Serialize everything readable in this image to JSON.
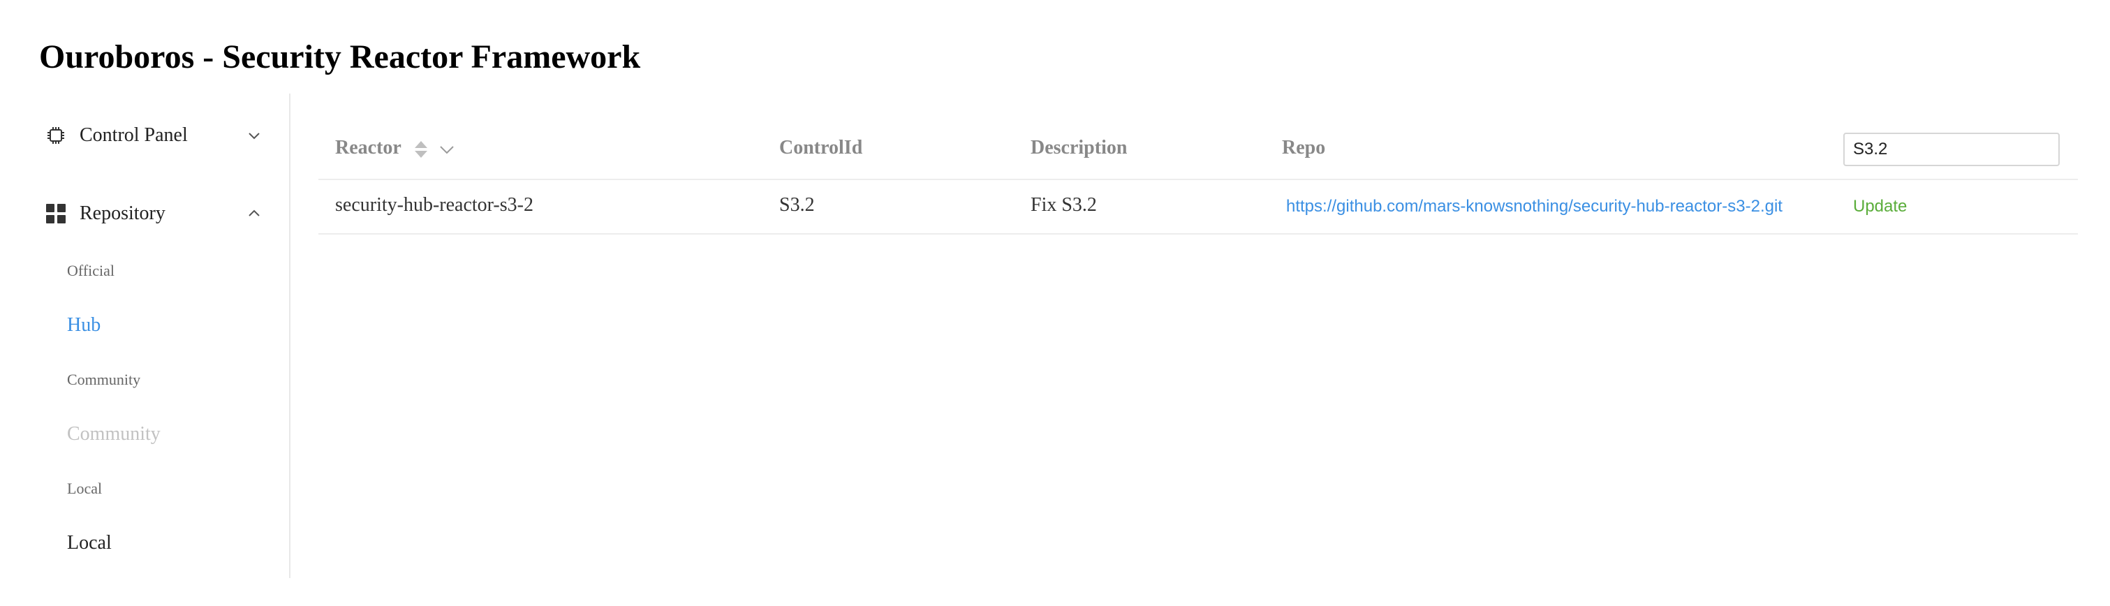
{
  "app": {
    "title": "Ouroboros - Security Reactor Framework"
  },
  "sidebar": {
    "control_panel": {
      "label": "Control Panel",
      "icon": "cpu-chip-icon",
      "expanded": false
    },
    "repository": {
      "label": "Repository",
      "icon": "grid-icon",
      "expanded": true,
      "items": [
        {
          "label": "Official",
          "state": "normal"
        },
        {
          "label": "Hub",
          "state": "selected"
        },
        {
          "label": "Community",
          "state": "normal"
        },
        {
          "label": "Community",
          "state": "disabled"
        },
        {
          "label": "Local",
          "state": "normal"
        },
        {
          "label": "Local",
          "state": "normal"
        }
      ]
    }
  },
  "table": {
    "columns": {
      "reactor": "Reactor",
      "control_id": "ControlId",
      "description": "Description",
      "repo": "Repo"
    },
    "search": {
      "value": "S3.2"
    },
    "rows": [
      {
        "reactor": "security-hub-reactor-s3-2",
        "control_id": "S3.2",
        "description": "Fix S3.2",
        "repo": "https://github.com/mars-knowsnothing/security-hub-reactor-s3-2.git",
        "action": "Update"
      }
    ]
  },
  "colors": {
    "accent": "#3a8fe3",
    "action": "#5aad3a",
    "disabled": "#c2c2c2",
    "header_text": "#888888",
    "divider": "#ededed"
  }
}
